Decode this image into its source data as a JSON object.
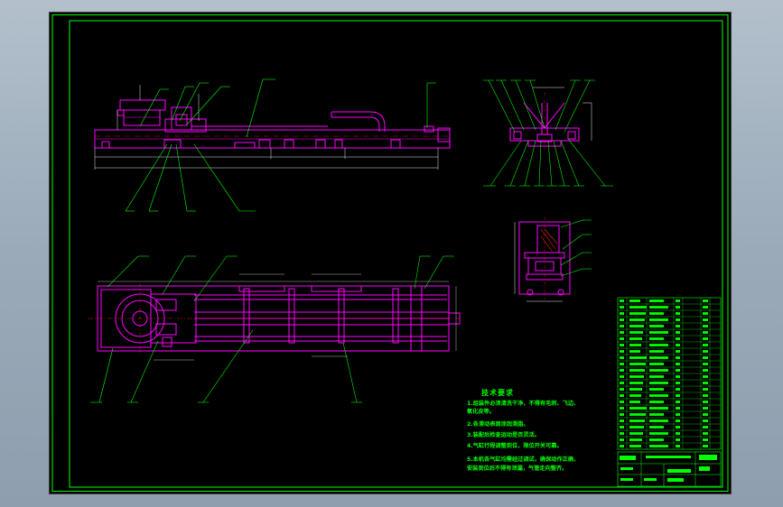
{
  "drawing": {
    "notes_title": "技术要求",
    "notes": [
      "1.组装件必须清洗干净，不得有毛刺、飞边、",
      "  氧化皮等。",
      "2.各滑动表面涂润滑脂。",
      "3.装配后检查运动是否灵活。",
      "4.气缸行程调整到位，限位开关可靠。",
      "5.本机各气缸均需经过调试，确保动作正确，",
      "  安装到位后不得有泄漏，气管走向整齐。"
    ]
  },
  "colors": {
    "frame": "#00ff00",
    "geometry": "#ff00ff",
    "dimension": "#e8e8e8",
    "background": "#000000"
  }
}
